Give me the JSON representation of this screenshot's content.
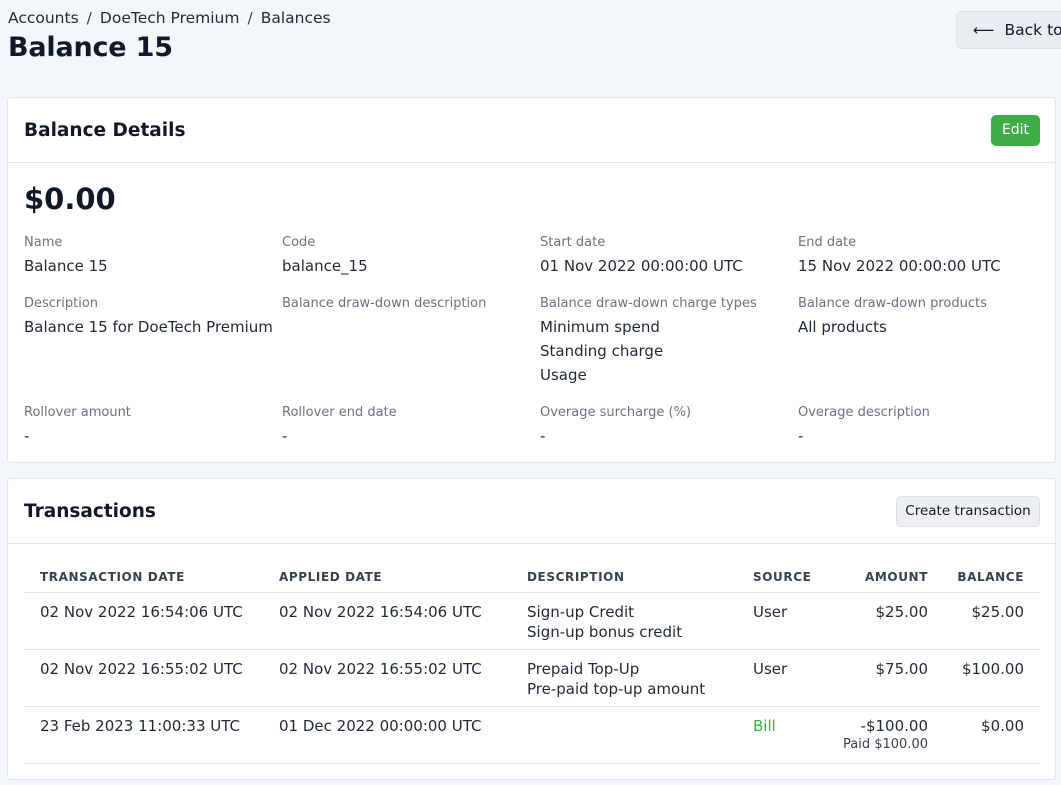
{
  "breadcrumb": {
    "items": [
      "Accounts",
      "DoeTech Premium",
      "Balances"
    ],
    "separator": "/"
  },
  "page": {
    "title": "Balance 15"
  },
  "back_button": {
    "arrow": "⟵",
    "label": "Back to D"
  },
  "details": {
    "title": "Balance Details",
    "edit_label": "Edit",
    "amount": "$0.00",
    "fields": {
      "name": {
        "label": "Name",
        "value": "Balance 15"
      },
      "code": {
        "label": "Code",
        "value": "balance_15"
      },
      "start_date": {
        "label": "Start date",
        "value": "01 Nov 2022 00:00:00 UTC"
      },
      "end_date": {
        "label": "End date",
        "value": "15 Nov 2022 00:00:00 UTC"
      },
      "description": {
        "label": "Description",
        "value": "Balance 15 for DoeTech Premium"
      },
      "drawdown_description": {
        "label": "Balance draw-down description",
        "value": ""
      },
      "drawdown_charge_types": {
        "label": "Balance draw-down charge types",
        "values": [
          "Minimum spend",
          "Standing charge",
          "Usage"
        ]
      },
      "drawdown_products": {
        "label": "Balance draw-down products",
        "value": "All products"
      },
      "rollover_amount": {
        "label": "Rollover amount",
        "value": "-"
      },
      "rollover_end_date": {
        "label": "Rollover end date",
        "value": "-"
      },
      "overage_surcharge": {
        "label": "Overage surcharge (%)",
        "value": "-"
      },
      "overage_description": {
        "label": "Overage description",
        "value": "-"
      }
    }
  },
  "transactions": {
    "title": "Transactions",
    "create_label": "Create transaction",
    "columns": [
      "Transaction date",
      "Applied date",
      "Description",
      "Source",
      "Amount",
      "Balance"
    ],
    "rows": [
      {
        "transaction_date": "02 Nov 2022 16:54:06 UTC",
        "applied_date": "02 Nov 2022 16:54:06 UTC",
        "description": "Sign-up Credit",
        "description_sub": "Sign-up bonus credit",
        "source": "User",
        "amount": "$25.00",
        "amount_sub": "",
        "balance": "$25.00"
      },
      {
        "transaction_date": "02 Nov 2022 16:55:02 UTC",
        "applied_date": "02 Nov 2022 16:55:02 UTC",
        "description": "Prepaid Top-Up",
        "description_sub": "Pre-paid top-up amount",
        "source": "User",
        "amount": "$75.00",
        "amount_sub": "",
        "balance": "$100.00"
      },
      {
        "transaction_date": "23 Feb 2023 11:00:33 UTC",
        "applied_date": "01 Dec 2022 00:00:00 UTC",
        "description": "",
        "description_sub": "",
        "source": "Bill",
        "amount": "-$100.00",
        "amount_sub": "Paid $100.00",
        "balance": "$0.00"
      }
    ]
  },
  "colors": {
    "accent_green": "#3fae49",
    "background": "#f4f7fa"
  }
}
